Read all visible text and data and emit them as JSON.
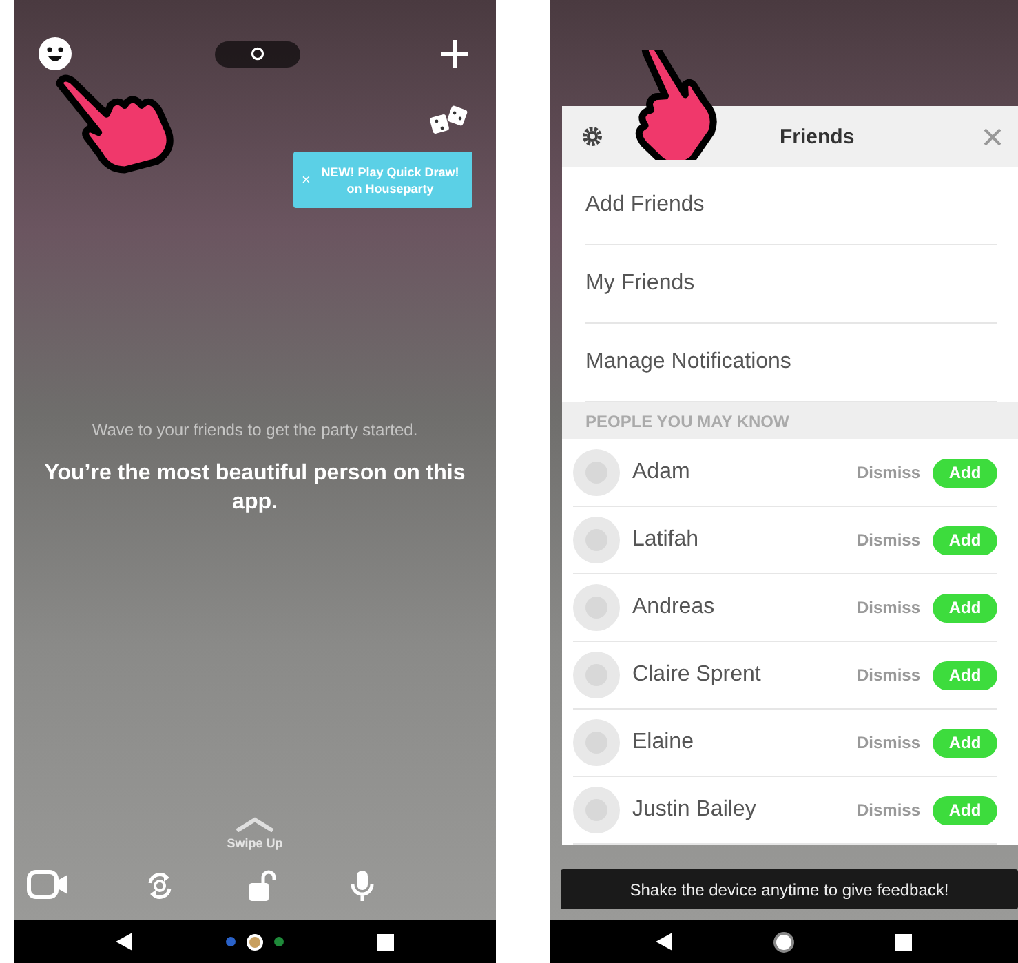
{
  "left_screen": {
    "tooltip": {
      "close": "×",
      "text": "NEW! Play Quick Draw! on Houseparty"
    },
    "prompt": "Wave to your friends to get the party started.",
    "message": "You’re the most beautiful person on this app.",
    "swipe_hint": "Swipe Up",
    "page_dots": [
      {
        "kind": "dot",
        "color": "#2a62c9",
        "selected": false
      },
      {
        "kind": "camera",
        "color": "#c9a060",
        "selected": true
      },
      {
        "kind": "dot",
        "color": "#1f8a3a",
        "selected": false
      }
    ]
  },
  "right_screen": {
    "panel": {
      "title": "Friends",
      "menu": [
        "Add Friends",
        "My Friends",
        "Manage Notifications"
      ],
      "section": "PEOPLE YOU MAY KNOW",
      "people": [
        {
          "name": "Adam",
          "dismiss": "Dismiss",
          "add": "Add"
        },
        {
          "name": "Latifah",
          "dismiss": "Dismiss",
          "add": "Add"
        },
        {
          "name": "Andreas",
          "dismiss": "Dismiss",
          "add": "Add"
        },
        {
          "name": "Claire Sprent",
          "dismiss": "Dismiss",
          "add": "Add"
        },
        {
          "name": "Elaine",
          "dismiss": "Dismiss",
          "add": "Add"
        },
        {
          "name": "Justin Bailey",
          "dismiss": "Dismiss",
          "add": "Add"
        }
      ]
    },
    "toast": "Shake the device anytime to give feedback!"
  }
}
